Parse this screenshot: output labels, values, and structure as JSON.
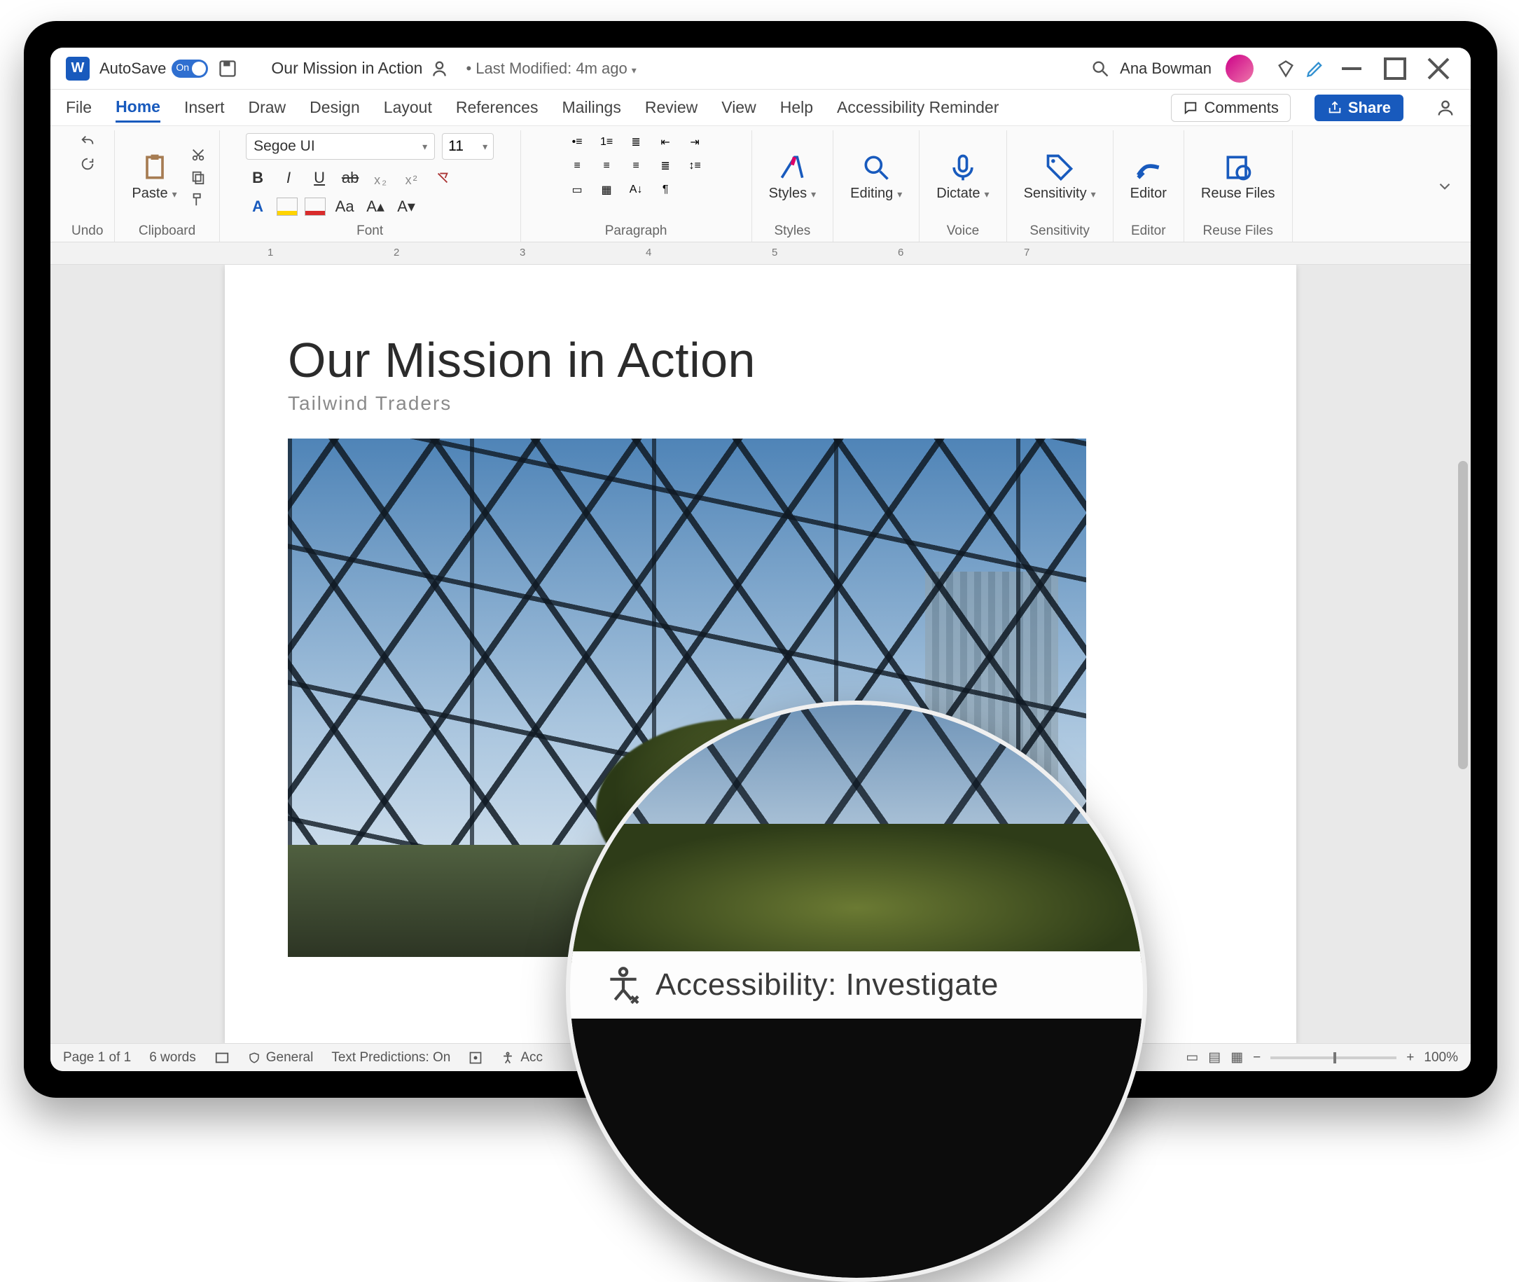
{
  "titlebar": {
    "app_letter": "W",
    "autosave_label": "AutoSave",
    "autosave_state": "On",
    "doc_title": "Our Mission in Action",
    "last_modified": "• Last Modified: 4m ago",
    "user_name": "Ana Bowman"
  },
  "ribbon_tabs": [
    "File",
    "Home",
    "Insert",
    "Draw",
    "Design",
    "Layout",
    "References",
    "Mailings",
    "Review",
    "View",
    "Help",
    "Accessibility Reminder"
  ],
  "active_tab": "Home",
  "buttons": {
    "comments": "Comments",
    "share": "Share"
  },
  "ribbon": {
    "undo": "Undo",
    "clipboard": {
      "paste": "Paste",
      "label": "Clipboard"
    },
    "font": {
      "name": "Segoe UI",
      "size": "11",
      "label": "Font"
    },
    "paragraph_label": "Paragraph",
    "styles": {
      "btn": "Styles",
      "label": "Styles"
    },
    "editing": "Editing",
    "voice": {
      "btn": "Dictate",
      "label": "Voice"
    },
    "sensitivity": {
      "btn": "Sensitivity",
      "label": "Sensitivity"
    },
    "editor": {
      "btn": "Editor",
      "label": "Editor"
    },
    "reuse": {
      "btn": "Reuse Files",
      "label": "Reuse Files"
    }
  },
  "ruler_ticks": [
    "1",
    "2",
    "3",
    "4",
    "5",
    "6",
    "7"
  ],
  "document": {
    "heading": "Our Mission in Action",
    "subtitle": "Tailwind Traders"
  },
  "status": {
    "page": "Page 1 of 1",
    "words": "6 words",
    "focus": "General",
    "predictions": "Text Predictions: On",
    "accessibility_short": "Acc",
    "zoom": "100%"
  },
  "callout": {
    "text": "Accessibility: Investigate"
  }
}
